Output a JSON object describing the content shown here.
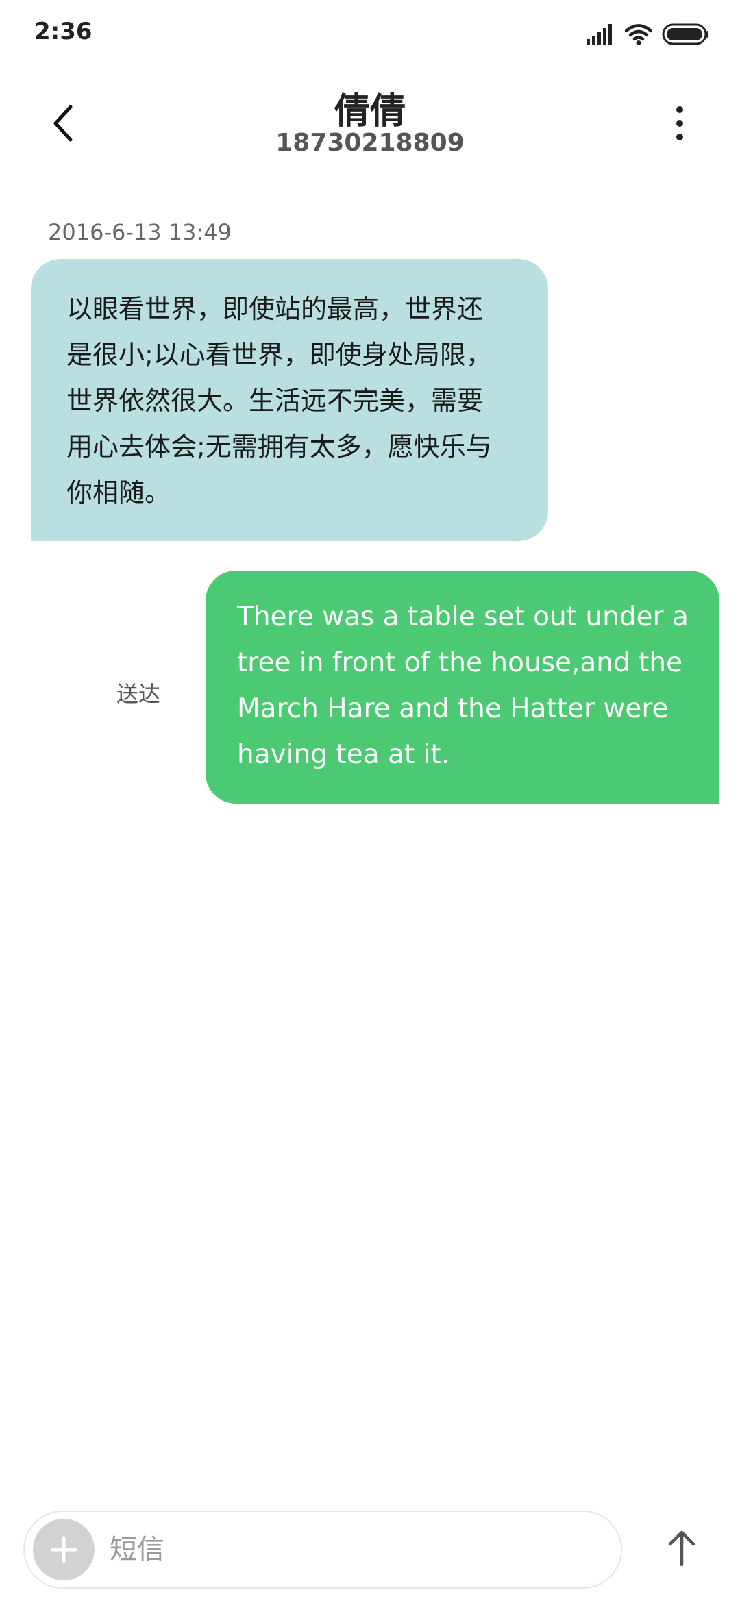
{
  "status_bar": {
    "time": "2:36",
    "icons": [
      "signal-icon",
      "wifi-icon",
      "battery-icon"
    ]
  },
  "header": {
    "back_icon": "chevron-left-icon",
    "contact_name": "倩倩",
    "contact_number": "18730218809",
    "more_icon": "more-vertical-icon"
  },
  "conversation": {
    "timestamp": "2016-6-13 13:49",
    "messages": [
      {
        "direction": "incoming",
        "text": "以眼看世界，即使站的最高，世界还是很小;以心看世界，即使身处局限，世界依然很大。生活远不完美，需要用心去体会;无需拥有太多，愿快乐与你相随。"
      },
      {
        "direction": "outgoing",
        "text": "There was a table set out under a tree in front of the house,and the March Hare and the Hatter were having tea at it.",
        "status": "送达"
      }
    ]
  },
  "composer": {
    "add_icon": "plus-icon",
    "placeholder": "短信",
    "value": "",
    "send_icon": "arrow-up-icon"
  },
  "colors": {
    "incoming_bubble": "#b9dfe0",
    "outgoing_bubble": "#4cc973",
    "add_button": "#d2d2d2"
  }
}
